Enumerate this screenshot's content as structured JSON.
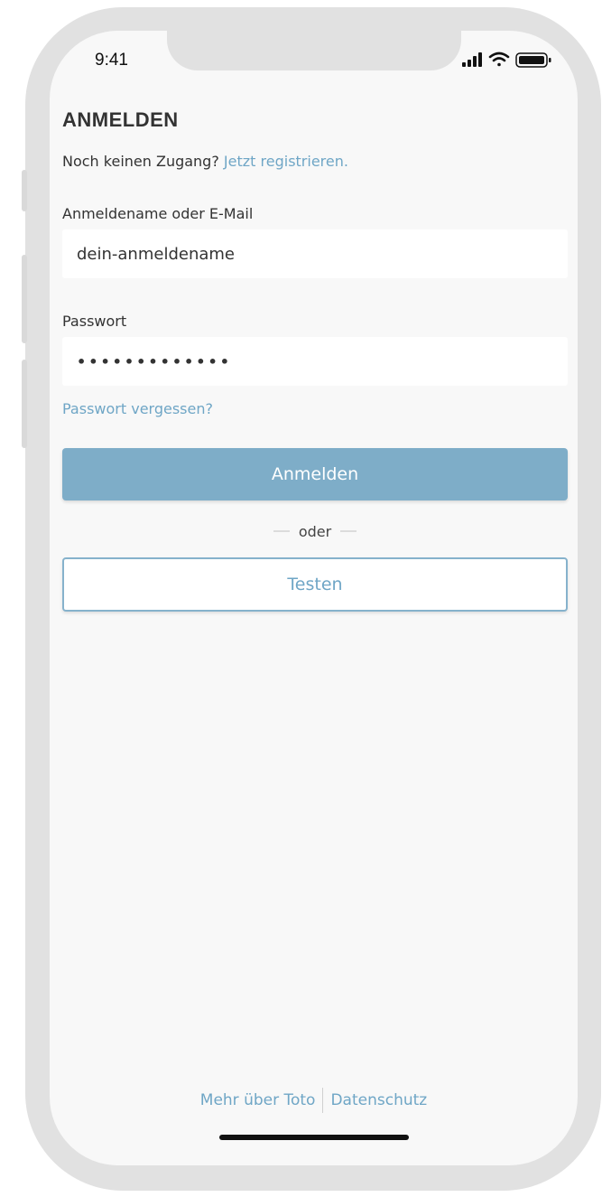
{
  "status_bar": {
    "time": "9:41",
    "icons": [
      "signal-icon",
      "wifi-icon",
      "battery-icon"
    ]
  },
  "login": {
    "title": "ANMELDEN",
    "no_account_text": "Noch keinen Zugang?",
    "register_link": "Jetzt registrieren.",
    "username_label": "Anmeldename oder E-Mail",
    "username_value": "dein-anmeldename",
    "password_label": "Passwort",
    "password_value": "•••••••••••••",
    "forgot_password": "Passwort vergessen?",
    "login_button": "Anmelden",
    "or_text": "oder",
    "test_button": "Testen"
  },
  "footer": {
    "about_link": "Mehr über Toto",
    "privacy_link": "Datenschutz"
  },
  "colors": {
    "accent": "#6fa6c6",
    "primary_button": "#7eadc8",
    "screen_background": "#f8f8f8",
    "frame": "#e1e1e1"
  }
}
